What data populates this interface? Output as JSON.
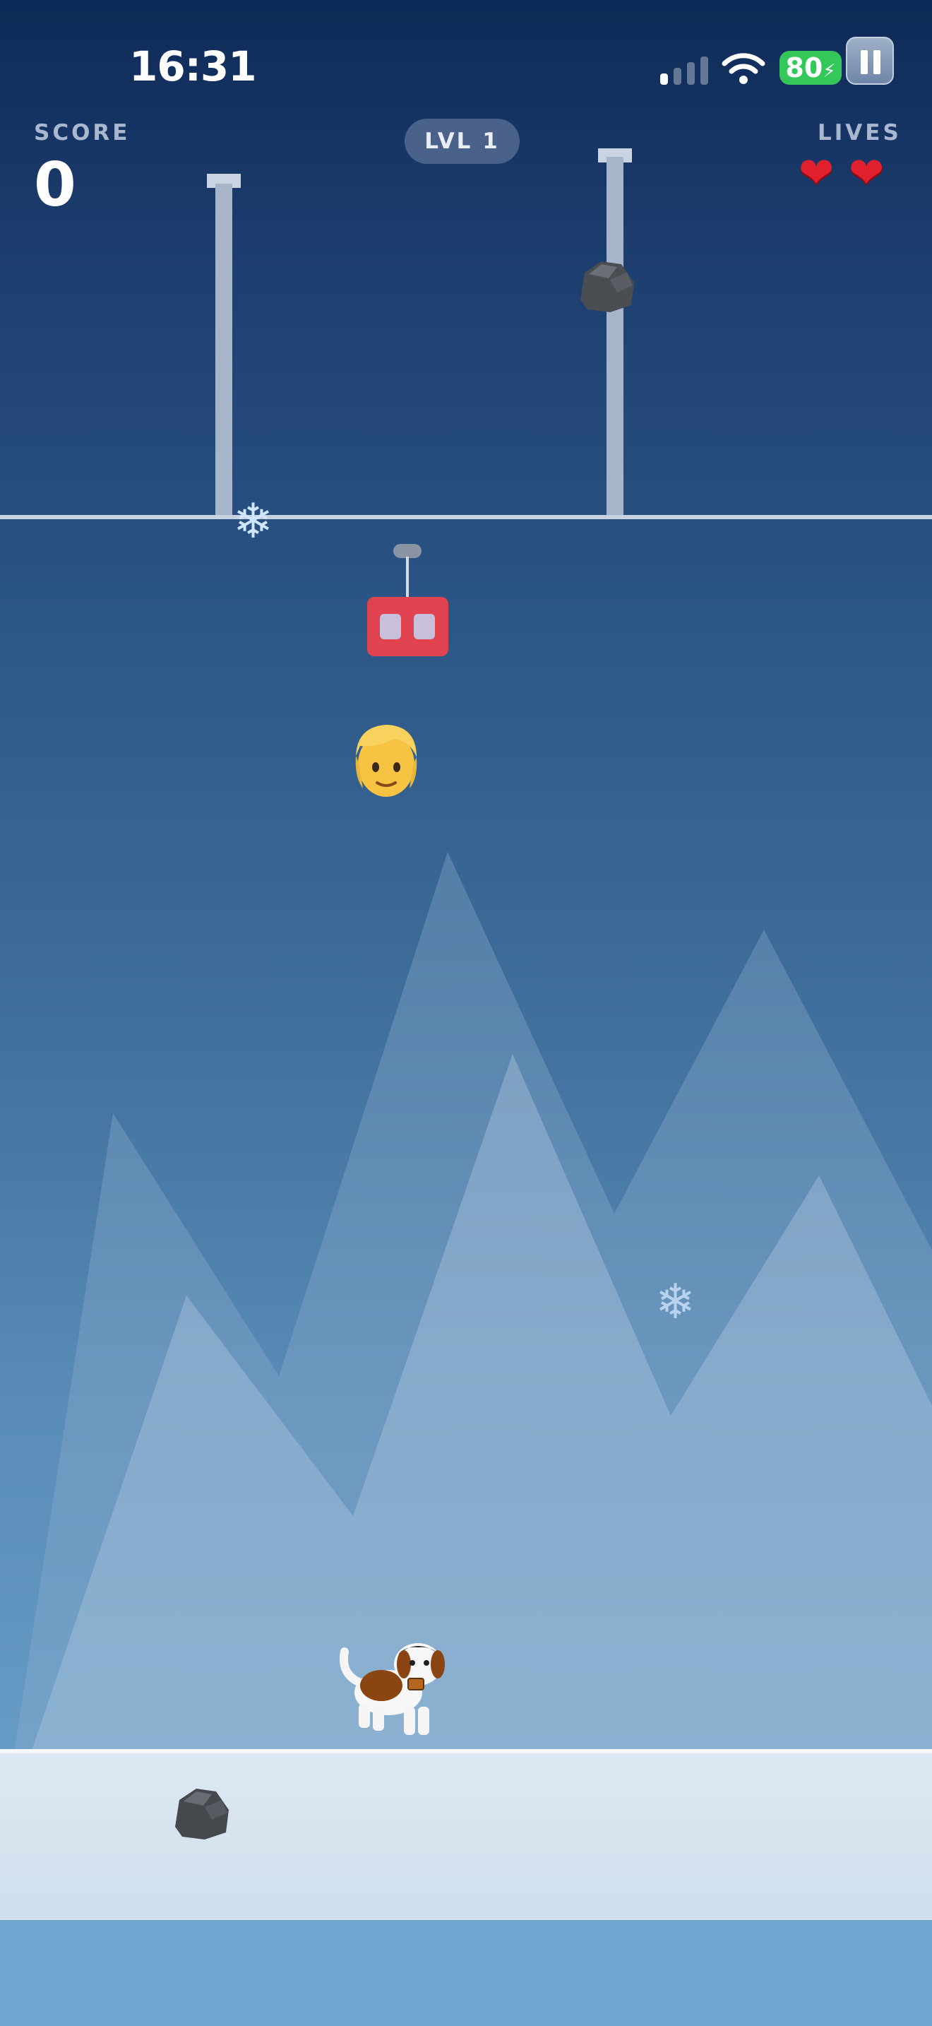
{
  "status_bar": {
    "time": "16:31",
    "battery": "80"
  },
  "hud": {
    "score_label": "SCORE",
    "score_value": "0",
    "level": "LVL 1",
    "lives_label": "LIVES",
    "lives": 2
  },
  "icons": {
    "heart": "❤",
    "snowflake": "❄"
  },
  "colors": {
    "gondola": "#e0424f",
    "battery": "#34c759",
    "heart": "#e0202c",
    "sky_top": "#0e2a57",
    "snow": "#dde8f2"
  }
}
